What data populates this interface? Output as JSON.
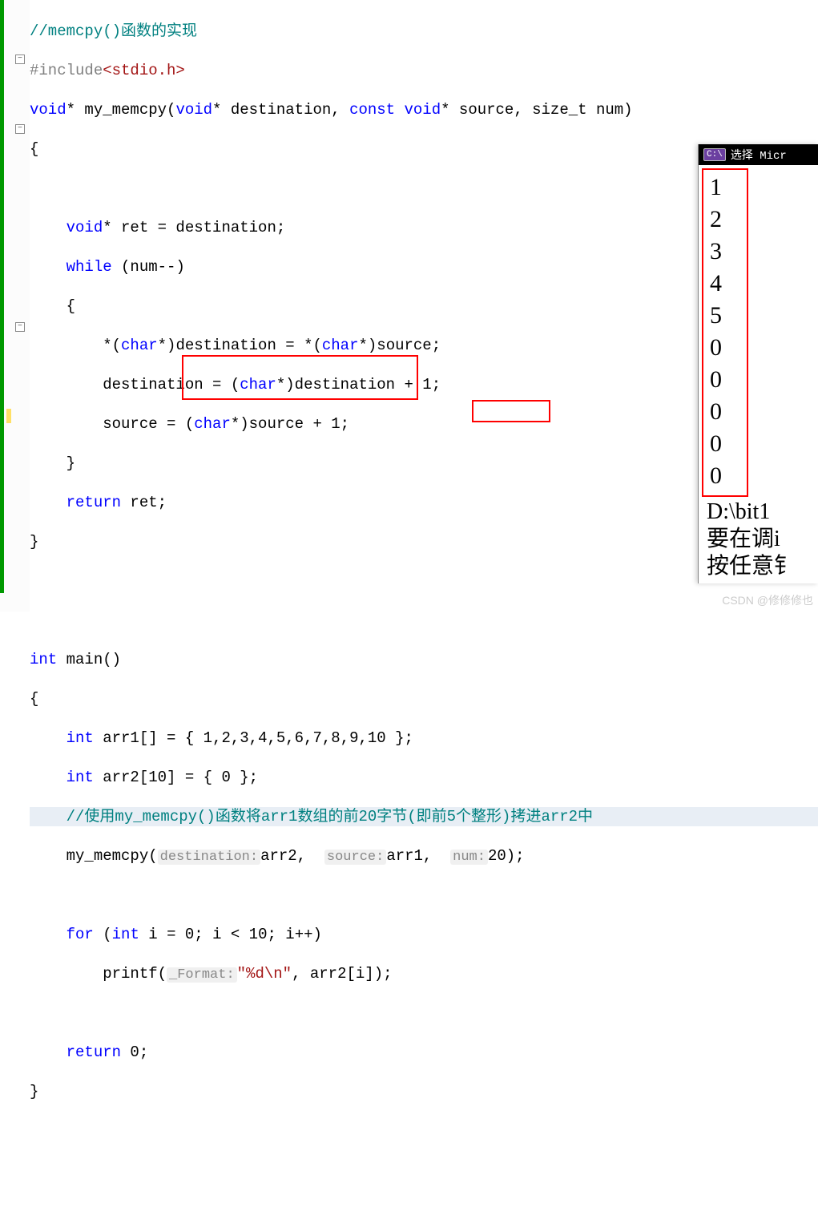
{
  "code": {
    "l1": "//memcpy()函数的实现",
    "l2a": "#include",
    "l2b": "<stdio.h>",
    "l3a": "void",
    "l3b": "* my_memcpy(",
    "l3c": "void",
    "l3d": "* destination, ",
    "l3e": "const",
    "l3f": " ",
    "l3g": "void",
    "l3h": "* source, size_t num)",
    "l4": "{",
    "l5a": "    void",
    "l5b": "* ret = destination;",
    "l6a": "    while",
    "l6b": " (num--)",
    "l7": "    {",
    "l8a": "        *(",
    "l8b": "char",
    "l8c": "*)destination = *(",
    "l8d": "char",
    "l8e": "*)source;",
    "l9a": "        destination = (",
    "l9b": "char",
    "l9c": "*)destination + 1;",
    "l10a": "        source = (",
    "l10b": "char",
    "l10c": "*)source + 1;",
    "l11": "    }",
    "l12a": "    return",
    "l12b": " ret;",
    "l13": "}",
    "l15a": "int",
    "l15b": " main()",
    "l16": "{",
    "l17a": "    int",
    "l17b": " arr1[] = ",
    "l17c": "{ 1,2,3,4,5,6,7,8,9,10 };",
    "l18a": "    int",
    "l18b": " arr2[10]",
    "l18c": " = { 0 };",
    "l19": "    //使用my_memcpy()函数将arr1数组的前20字节(即前5个整形)拷进arr2中",
    "l20a": "    my_memcpy(",
    "l20h1": "destination:",
    "l20b": "arr2, ",
    "l20h2": "source:",
    "l20c": "arr1, ",
    "l20h3": "num:",
    "l20d": "20);",
    "l22a": "    for",
    "l22b": " (",
    "l22c": "int",
    "l22d": " i = 0; i < 10; i++)",
    "l23a": "        printf(",
    "l23h": "_Format:",
    "l23b": "\"%d\\n\"",
    "l23c": ", arr2[i]);",
    "l25a": "    return",
    "l25b": " 0;",
    "l26": "}"
  },
  "console": {
    "title": "选择 Micr",
    "output": [
      "1",
      "2",
      "3",
      "4",
      "5",
      "0",
      "0",
      "0",
      "0",
      "0"
    ],
    "tail1": "D:\\bit1",
    "tail2": "要在调i",
    "tail3": "按任意钅"
  },
  "watermark": "CSDN @修修修也"
}
